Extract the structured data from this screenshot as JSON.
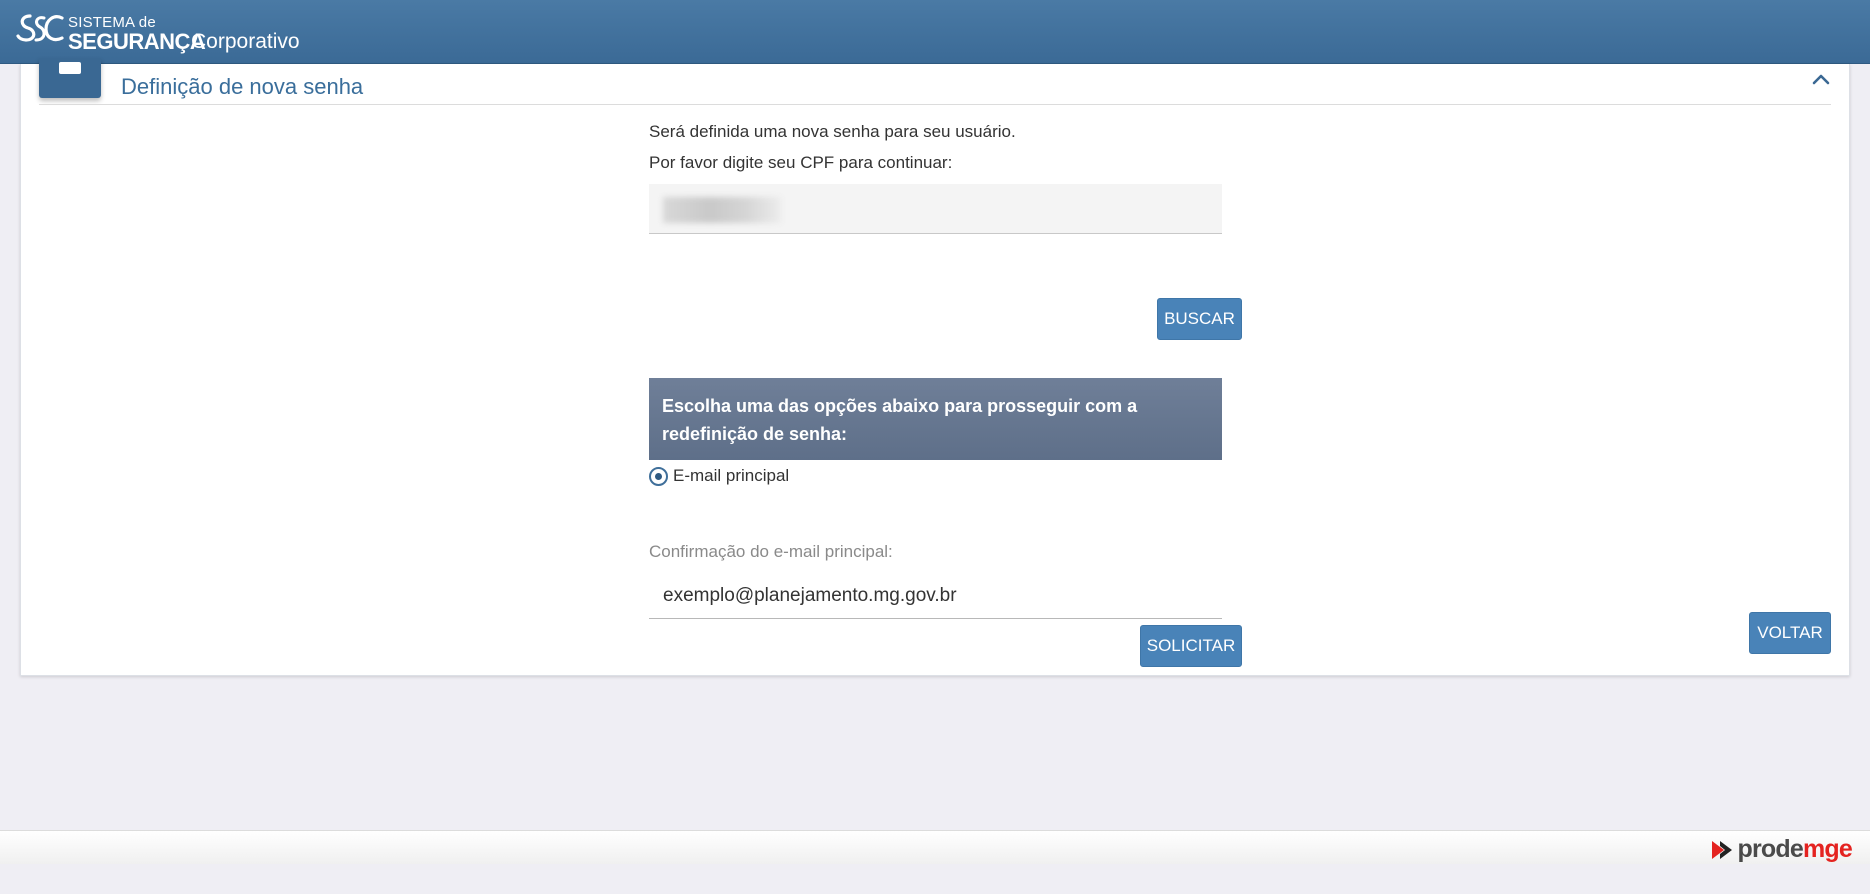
{
  "header": {
    "logo_line1": "SISTEMA de",
    "logo_line2": "SEGURANÇA",
    "logo_line3": "Corporativo",
    "background": "#3b6a96"
  },
  "card": {
    "title": "Definição de nova senha",
    "collapse_icon": "chevron-up-icon"
  },
  "form": {
    "intro_line1": "Será definida uma nova senha para seu usuário.",
    "intro_line2": "Por favor digite seu CPF para continuar:",
    "cpf_value": "",
    "buscar_label": "BUSCAR",
    "options_header": "Escolha uma das opções abaixo para prosseguir com a redefinição de senha:",
    "radio_option_label": "E-mail principal",
    "radio_selected": true,
    "email_confirm_label": "Confirmação do e-mail principal:",
    "email_value": "exemplo@planejamento.mg.gov.br",
    "solicitar_label": "SOLICITAR"
  },
  "voltar_label": "VOLTAR",
  "footer": {
    "brand_prefix": "prode",
    "brand_highlight": "mg",
    "brand_suffix": "e",
    "accent": "#e42320"
  }
}
